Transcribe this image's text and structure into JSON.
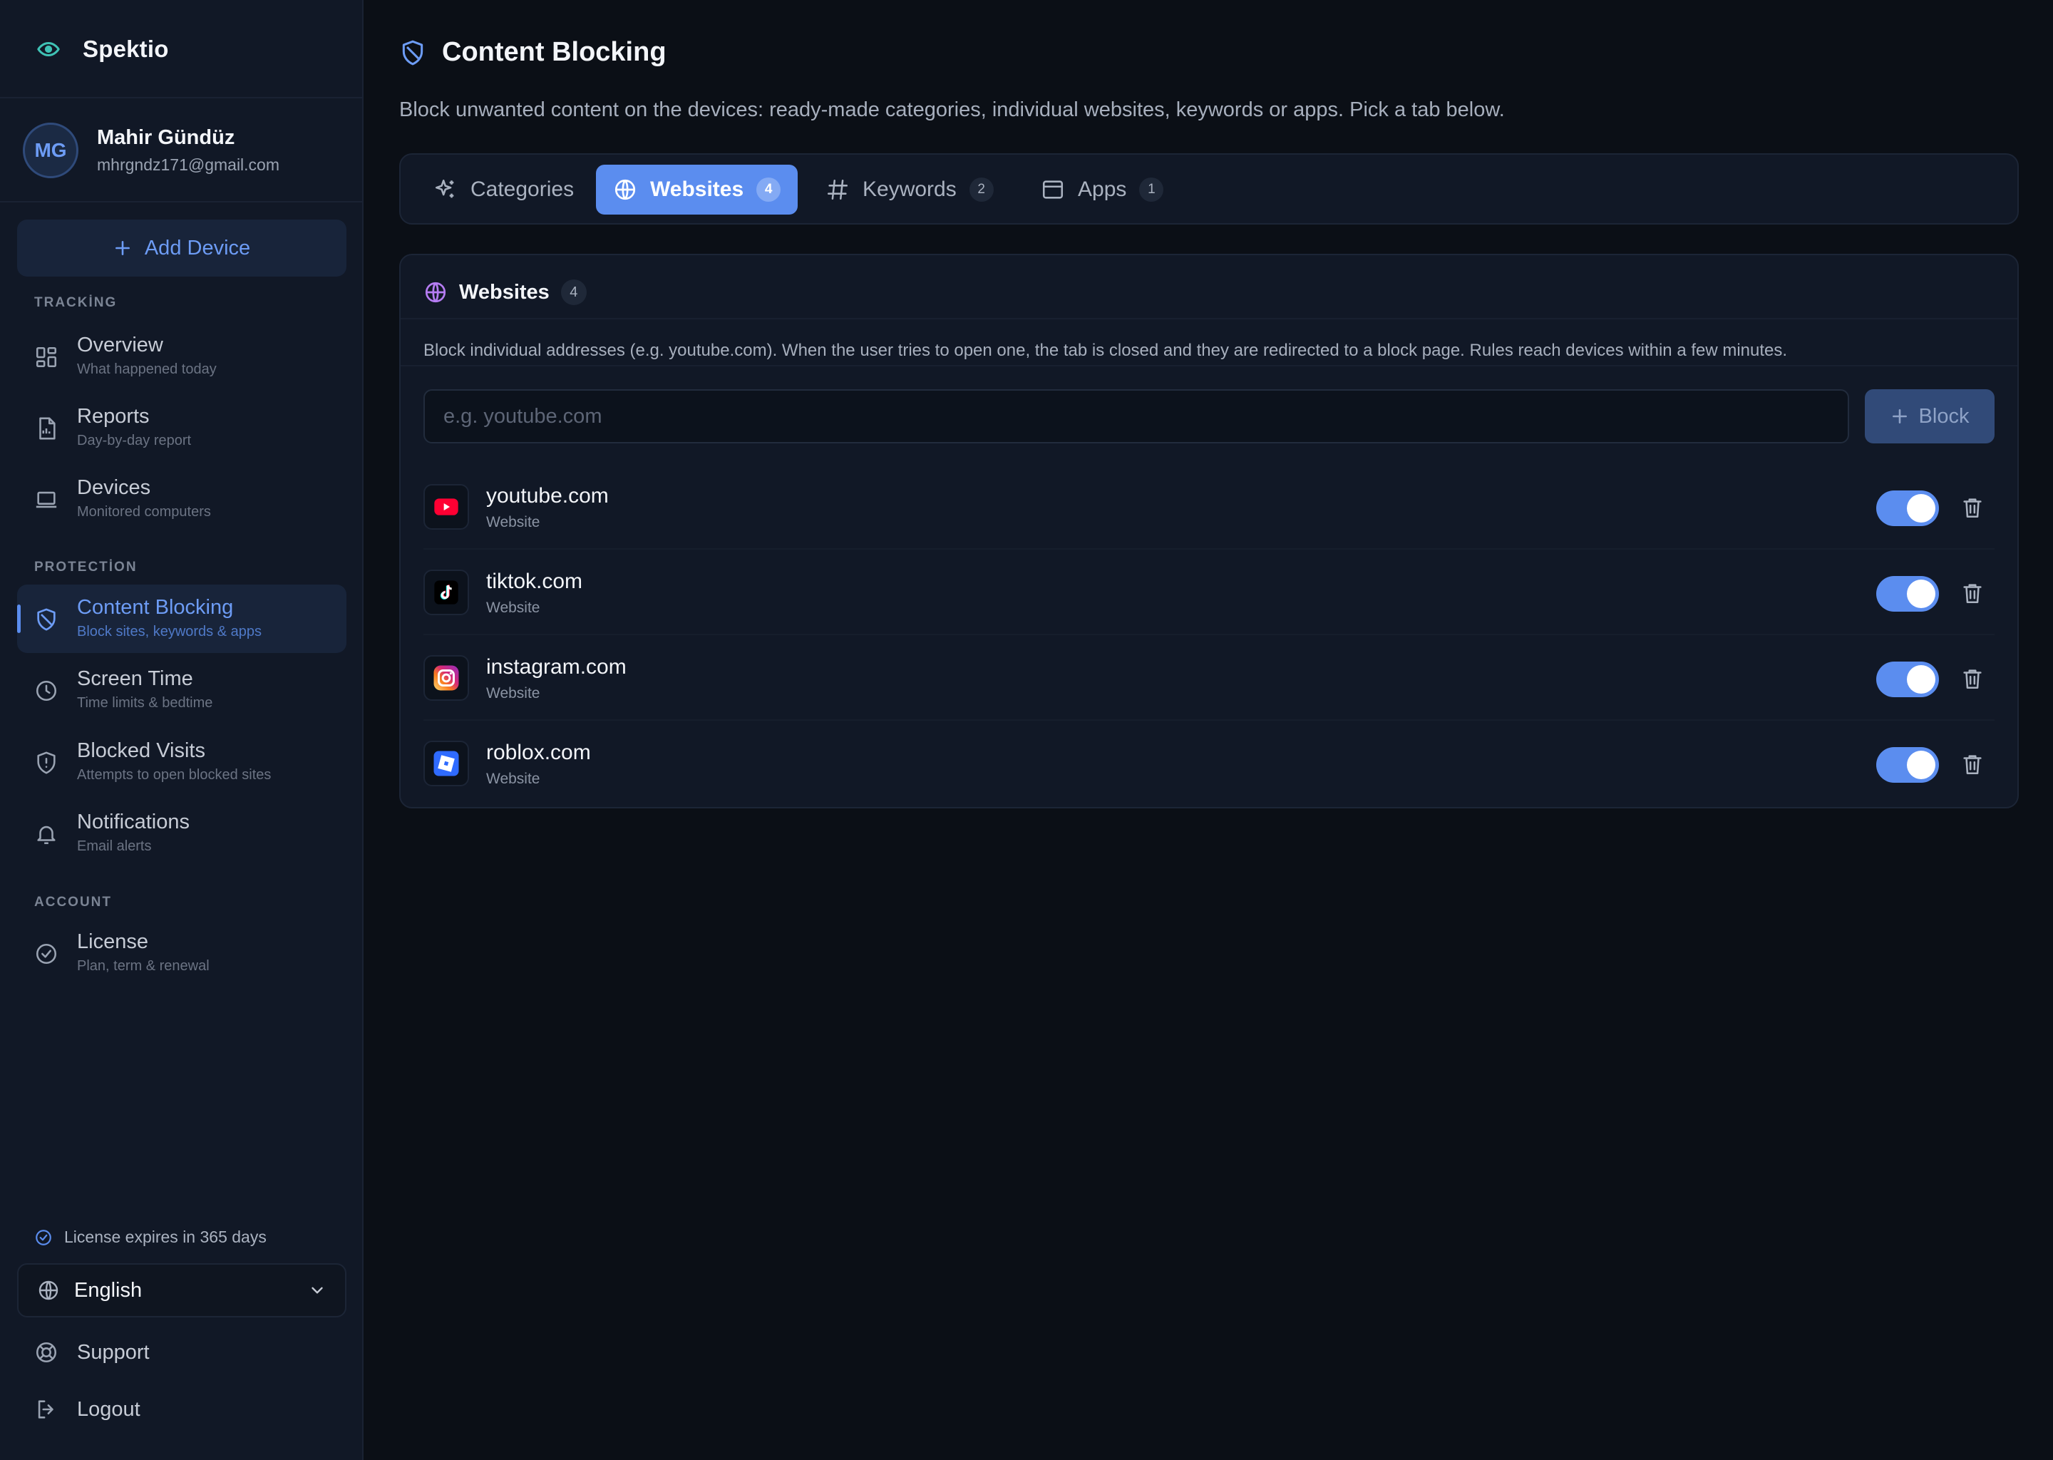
{
  "brand": {
    "name": "Spektio"
  },
  "user": {
    "initials": "MG",
    "name": "Mahir Gündüz",
    "email": "mhrgndz171@gmail.com"
  },
  "sidebar": {
    "add_device_label": "Add Device",
    "sections": [
      {
        "label": "TRACKİNG"
      },
      {
        "label": "PROTECTİON"
      },
      {
        "label": "ACCOUNT"
      }
    ],
    "items": [
      {
        "title": "Overview",
        "subtitle": "What happened today",
        "icon": "grid-icon"
      },
      {
        "title": "Reports",
        "subtitle": "Day-by-day report",
        "icon": "report-icon"
      },
      {
        "title": "Devices",
        "subtitle": "Monitored computers",
        "icon": "laptop-icon"
      },
      {
        "title": "Content Blocking",
        "subtitle": "Block sites, keywords & apps",
        "icon": "shield-icon",
        "active": true
      },
      {
        "title": "Screen Time",
        "subtitle": "Time limits & bedtime",
        "icon": "clock-icon"
      },
      {
        "title": "Blocked Visits",
        "subtitle": "Attempts to open blocked sites",
        "icon": "shield-alert-icon"
      },
      {
        "title": "Notifications",
        "subtitle": "Email alerts",
        "icon": "bell-icon"
      },
      {
        "title": "License",
        "subtitle": "Plan, term & renewal",
        "icon": "badge-check-icon"
      }
    ],
    "license_note": "License expires in 365 days",
    "language": "English",
    "support_label": "Support",
    "logout_label": "Logout"
  },
  "page": {
    "title": "Content Blocking",
    "description": "Block unwanted content on the devices: ready-made categories, individual websites, keywords or apps. Pick a tab below."
  },
  "tabs": [
    {
      "label": "Categories",
      "count": ""
    },
    {
      "label": "Websites",
      "count": "4",
      "active": true
    },
    {
      "label": "Keywords",
      "count": "2"
    },
    {
      "label": "Apps",
      "count": "1"
    }
  ],
  "panel": {
    "title": "Websites",
    "count": "4",
    "description": "Block individual addresses (e.g. youtube.com). When the user tries to open one, the tab is closed and they are redirected to a block page. Rules reach devices within a few minutes.",
    "input_placeholder": "e.g. youtube.com",
    "input_value": "",
    "block_label": "Block",
    "sites": [
      {
        "name": "youtube.com",
        "type": "Website",
        "enabled": true,
        "icon": "youtube-icon"
      },
      {
        "name": "tiktok.com",
        "type": "Website",
        "enabled": true,
        "icon": "tiktok-icon"
      },
      {
        "name": "instagram.com",
        "type": "Website",
        "enabled": true,
        "icon": "instagram-icon"
      },
      {
        "name": "roblox.com",
        "type": "Website",
        "enabled": true,
        "icon": "roblox-icon"
      }
    ]
  },
  "colors": {
    "accent": "#5b8def",
    "background": "#0b0f16",
    "sidebar": "#111826"
  }
}
